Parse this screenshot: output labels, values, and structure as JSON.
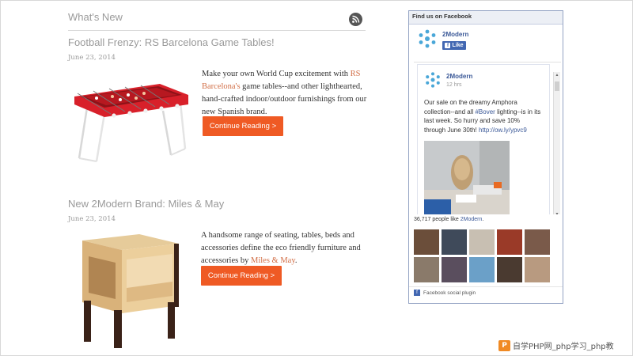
{
  "section": {
    "title": "What's New"
  },
  "posts": [
    {
      "title": "Football Frenzy: RS Barcelona Game Tables!",
      "date": "June 23, 2014",
      "text_before": "Make your own World Cup excitement with ",
      "text_link": "RS Barcelona's",
      "text_after": " game tables--and other lighthearted, hand-crafted indoor/outdoor furnishings from our new Spanish brand.",
      "button": "Continue Reading >"
    },
    {
      "title": "New 2Modern Brand: Miles & May",
      "date": "June 23, 2014",
      "text_before": "A handsome range of seating, tables, beds and accessories define the eco friendly furniture and accessories by ",
      "text_link": "Miles & May",
      "text_after": ".",
      "button": "Continue Reading >"
    }
  ],
  "facebook": {
    "header": "Find us on Facebook",
    "page_name": "2Modern",
    "like_label": "Like",
    "post": {
      "name": "2Modern",
      "time": "12 hrs",
      "text_1": "Our sale on the dreamy Amphora collection--and all ",
      "hashtag": "#Bover",
      "text_2": " lighting--is in its last week. So hurry and save 10% through June 30th! ",
      "link": "http://ow.ly/ypvc9"
    },
    "likes_count": "36,717 people like ",
    "likes_page": "2Modern",
    "likes_end": ".",
    "footer": "Facebook social plugin",
    "colors": {
      "brand": "#3b5998",
      "button": "#4267b2",
      "accent_button": "#ef5a24"
    }
  },
  "watermark": {
    "text": "自学PHP网_php学习_php教"
  }
}
